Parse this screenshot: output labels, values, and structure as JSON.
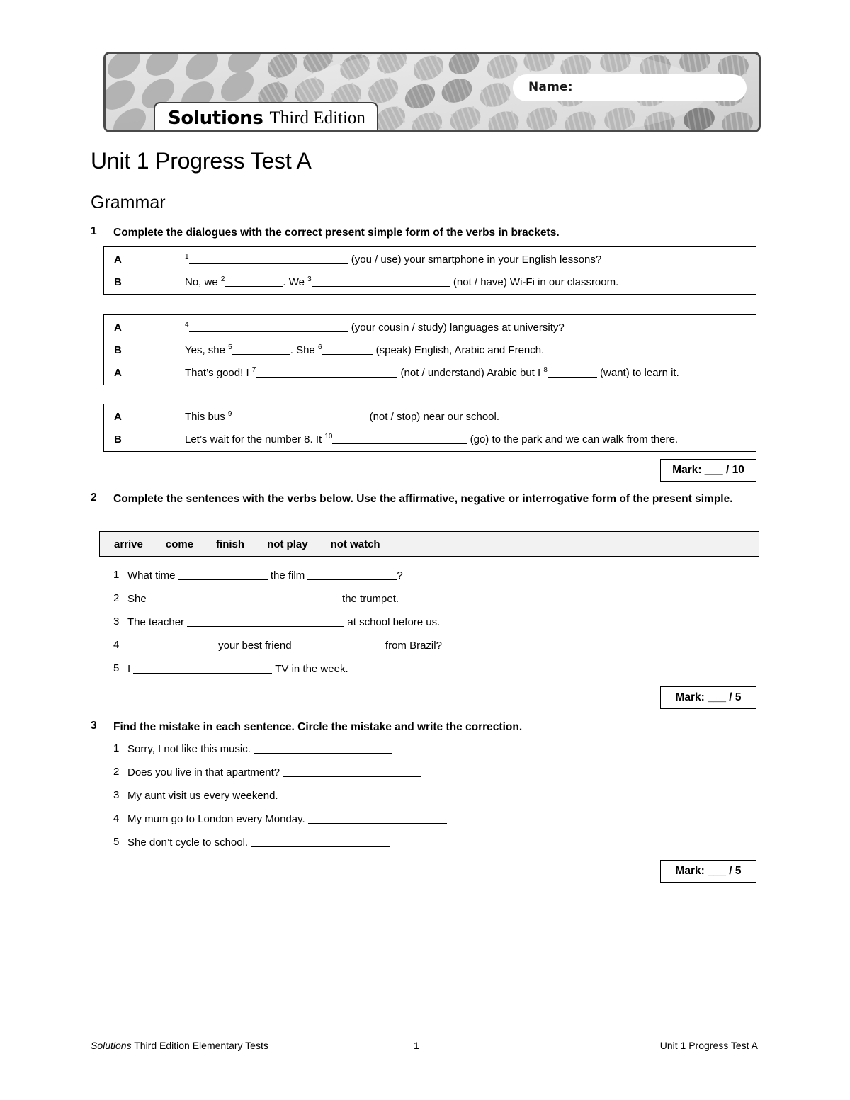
{
  "header": {
    "name_label": "Name:",
    "logo_primary": "Solutions",
    "logo_secondary": "Third Edition"
  },
  "document": {
    "title": "Unit 1 Progress Test A",
    "section": "Grammar"
  },
  "exercises": [
    {
      "number": "1",
      "instruction": "Complete the dialogues with the correct present simple form of the verbs in brackets.",
      "mark_label": "Mark: ___ / 10",
      "dialogues": [
        {
          "lines": [
            {
              "speaker": "A",
              "text": "¹______________________ (you / use) your smartphone in your English lessons?"
            },
            {
              "speaker": "B",
              "text": "No, we ²__________. We ³_______________________ (not / have) Wi-Fi in our classroom."
            }
          ]
        },
        {
          "lines": [
            {
              "speaker": "A",
              "text": "⁴______________________ (your cousin / study) languages at university?"
            },
            {
              "speaker": "B",
              "text": "Yes, she ⁵__________. She ⁶_________ (speak) English, Arabic and French."
            },
            {
              "speaker": "A",
              "text": "That's good! I ⁷_______________________ (not / understand) Arabic but I ⁸________ (want) to learn it."
            }
          ]
        },
        {
          "lines": [
            {
              "speaker": "A",
              "text": "This bus ⁹______________________ (not / stop) near our school."
            },
            {
              "speaker": "B",
              "text": "Let's wait for the number 8. It ¹⁰______________________ (go) to the park and we can walk from there."
            }
          ]
        }
      ]
    },
    {
      "number": "2",
      "instruction": "Complete the sentences with the verbs below. Use the affirmative, negative or interrogative form of the present simple.",
      "mark_label": "Mark: ___ / 5",
      "word_bank": [
        "arrive",
        "come",
        "finish",
        "not play",
        "not watch"
      ],
      "items": [
        {
          "num": "1",
          "text": "What time _____________ the film _____________?"
        },
        {
          "num": "2",
          "text": "She ______________________________ the trumpet."
        },
        {
          "num": "3",
          "text": "The teacher ________________________ at school before us."
        },
        {
          "num": "4",
          "text": "_____________ your best friend _____________ from Brazil?"
        },
        {
          "num": "5",
          "text": "I _______________________ TV in the week."
        }
      ]
    },
    {
      "number": "3",
      "instruction": "Find the mistake in each sentence. Circle the mistake and write the correction.",
      "mark_label": "Mark: ___ / 5",
      "items": [
        {
          "num": "1",
          "text": "Sorry, I not like this music. ____________________________"
        },
        {
          "num": "2",
          "text": "Does you live in that apartment? ____________________________"
        },
        {
          "num": "3",
          "text": "My aunt visit us every weekend. ____________________________"
        },
        {
          "num": "4",
          "text": "My mum go to London every Monday. ____________________________"
        },
        {
          "num": "5",
          "text": "She don't cycle to school. ____________________________"
        }
      ]
    }
  ],
  "footer": {
    "left_italic": "Solutions",
    "left_rest": " Third Edition Elementary Tests",
    "page_number": "1",
    "right": "Unit 1 Progress Test A"
  },
  "colors": {
    "page_bg": "#ffffff",
    "text": "#000000",
    "wordbank_bg": "#f2f2f2",
    "banner_border": "#4a4a4a"
  }
}
